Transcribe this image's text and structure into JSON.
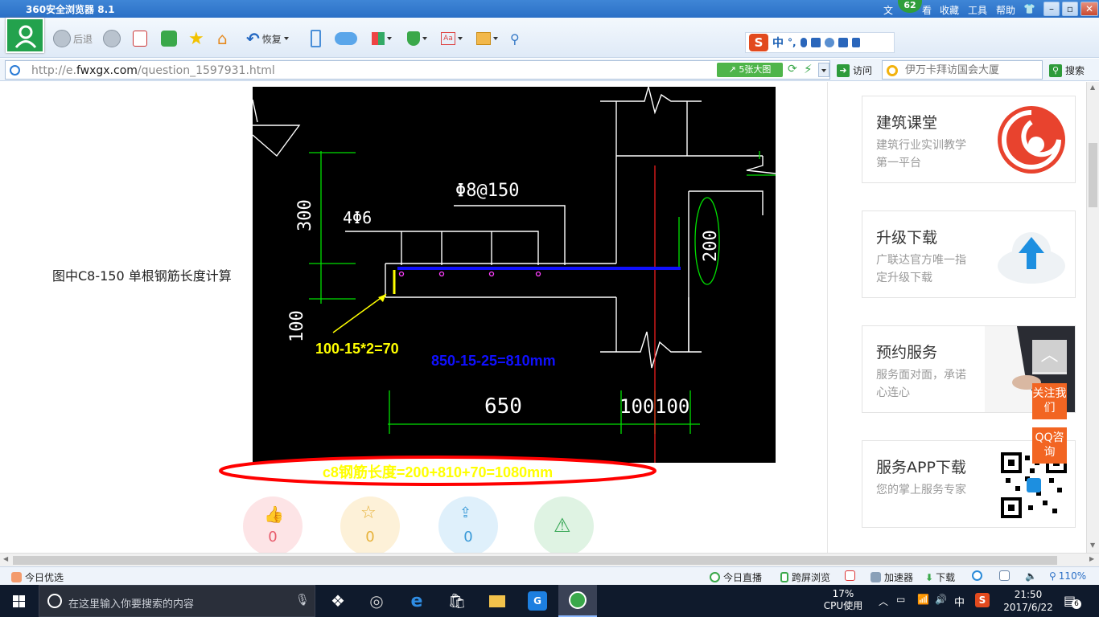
{
  "window": {
    "title": "360安全浏览器 8.1",
    "menu": [
      "文",
      "看",
      "收藏",
      "工具",
      "帮助"
    ],
    "badge": "62"
  },
  "toolbar": {
    "back_label": "后退",
    "restore_label": "恢复"
  },
  "ime": {
    "mode": "中",
    "punct": "°,"
  },
  "address": {
    "url_prefix": "http://e.",
    "url_domain": "fwxgx.com",
    "url_path": "/question_1597931.html",
    "big_images_label": "5张大图",
    "visit_label": "访问",
    "search_placeholder": "伊万卡拜访国会大厦",
    "search_label": "搜索"
  },
  "content": {
    "question_text": "图中C8-150 单根钢筋长度计算",
    "cad": {
      "label_phi8": "Φ8@150",
      "label_4phi6": "4Φ6",
      "dim_300": "300",
      "dim_100": "100",
      "dim_200": "200",
      "dim_650": "650",
      "dim_100a": "100",
      "dim_100b": "100",
      "annot_yellow": "100-15*2=70",
      "annot_blue": "850-15-25=810mm"
    },
    "answer_text": "c8钢筋长度=200+810+70=1080mm",
    "actions": [
      {
        "name": "like",
        "count": "0"
      },
      {
        "name": "favorite",
        "count": "0"
      },
      {
        "name": "share",
        "count": "0"
      },
      {
        "name": "report",
        "count": ""
      }
    ]
  },
  "sidebar": {
    "cards": [
      {
        "title": "建筑课堂",
        "desc": "建筑行业实训教学第一平台"
      },
      {
        "title": "升级下载",
        "desc": "广联达官方唯一指定升级下载"
      },
      {
        "title": "预约服务",
        "desc": "服务面对面，承诺心连心"
      },
      {
        "title": "服务APP下载",
        "desc": "您的掌上服务专家"
      }
    ],
    "follow_label": "关注我们",
    "qq_label": "QQ咨询"
  },
  "statusbar": {
    "left": "今日优选",
    "live": "今日直播",
    "cross_screen": "跨屏浏览",
    "accelerator": "加速器",
    "download": "下载",
    "zoom": "110%"
  },
  "taskbar": {
    "search_placeholder": "在这里输入你要搜索的内容",
    "cpu_percent": "17%",
    "cpu_label": "CPU使用",
    "ime": "中",
    "time": "21:50",
    "date": "2017/6/22",
    "notifications": "6"
  },
  "colors": {
    "accent": "#2a6fc6",
    "brand_green": "#23a24d",
    "fab_orange": "#f26522",
    "answer_yellow": "#ffff00",
    "ellipse_red": "#ff0000"
  }
}
